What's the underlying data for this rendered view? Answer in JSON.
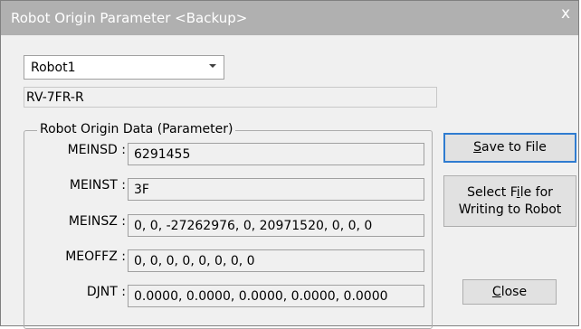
{
  "window": {
    "title": "Robot Origin Parameter <Backup>",
    "close_glyph": "x"
  },
  "robot_select": {
    "value": "Robot1"
  },
  "model": {
    "value": "RV-7FR-R"
  },
  "group": {
    "legend": "Robot Origin Data (Parameter)",
    "params": [
      {
        "label": "MEINSD :",
        "value": "6291455"
      },
      {
        "label": "MEINST :",
        "value": "3F"
      },
      {
        "label": "MEINSZ :",
        "value": "0, 0, -27262976, 0, 20971520, 0, 0, 0"
      },
      {
        "label": "MEOFFZ :",
        "value": "0, 0, 0, 0, 0, 0, 0, 0"
      },
      {
        "label": "DJNT :",
        "value": "0.0000, 0.0000, 0.0000, 0.0000, 0.0000"
      }
    ]
  },
  "buttons": {
    "save_prefix": "S",
    "save_rest": "ave to File",
    "select_line1_prefix": "Select F",
    "select_line1_accel": "i",
    "select_line1_rest": "le for",
    "select_line2": "Writing to Robot",
    "close_accel": "C",
    "close_rest": "lose"
  },
  "colors": {
    "titlebar": "#b0b0b0",
    "client": "#f0f0f0",
    "default_button_border": "#2f7cd0"
  }
}
